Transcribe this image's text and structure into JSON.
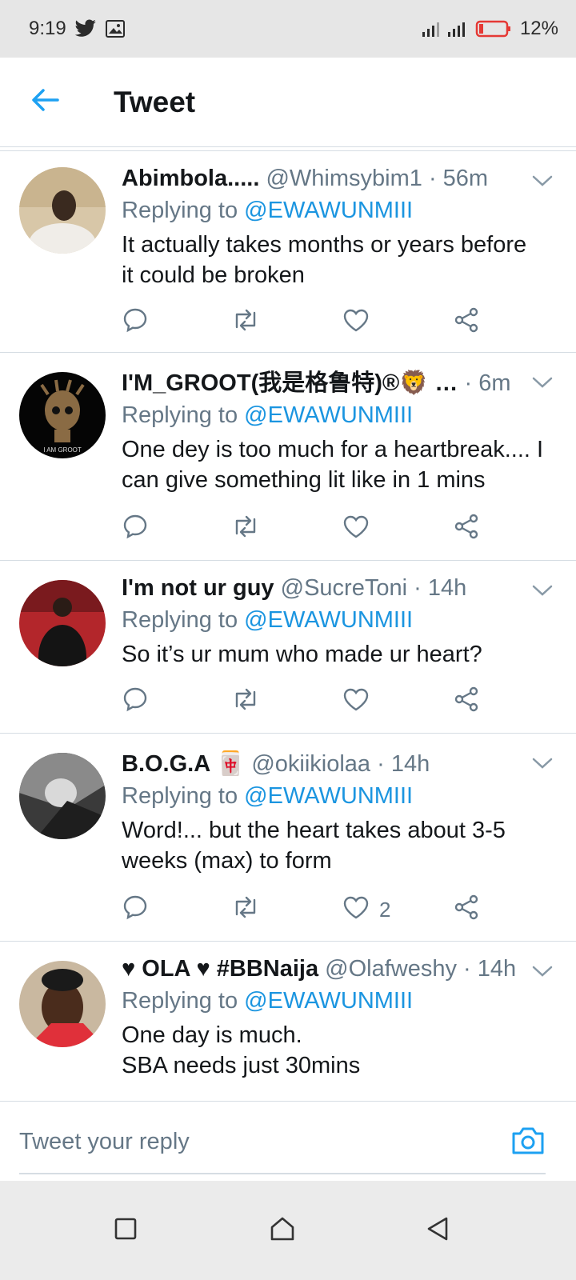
{
  "status_bar": {
    "time": "9:19",
    "battery": "12%",
    "battery_color": "#e53935",
    "icons": [
      "twitter-icon",
      "gallery-icon",
      "signal-icon",
      "battery-icon"
    ]
  },
  "header": {
    "title": "Tweet",
    "accent": "#1da1f2"
  },
  "tweets": [
    {
      "name": "Abimbola.....",
      "handle": "@Whimsybim1",
      "dot": "·",
      "time": "56m",
      "replying_prefix": "Replying to",
      "replying_to": "@EWAWUNMIII",
      "lines": [
        "It actually takes months or years before",
        "it could be broken"
      ],
      "likes": ""
    },
    {
      "name": "I'M_GROOT(我是格鲁特)®🦁 …",
      "handle": "",
      "dot": "·",
      "time": "6m",
      "replying_prefix": "Replying to",
      "replying_to": "@EWAWUNMIII",
      "lines": [
        "One dey is too much for a heartbreak.... I",
        "can give something lit like in 1 mins"
      ],
      "likes": ""
    },
    {
      "name": "I'm not ur guy",
      "handle": "@SucreToni",
      "dot": "·",
      "time": "14h",
      "replying_prefix": "Replying to",
      "replying_to": "@EWAWUNMIII",
      "lines": [
        "So it’s ur mum who made ur heart?"
      ],
      "likes": ""
    },
    {
      "name": "B.O.G.A 🀄",
      "handle": "@okiikiolaa",
      "dot": "·",
      "time": "14h",
      "replying_prefix": "Replying to",
      "replying_to": "@EWAWUNMIII",
      "lines": [
        "Word!... but the heart takes about 3-5",
        "weeks (max) to form"
      ],
      "likes": "2"
    },
    {
      "name": "♥ OLA ♥ #BBNaija",
      "handle": "@Olafweshy",
      "dot": "·",
      "time": "14h",
      "replying_prefix": "Replying to",
      "replying_to": "@EWAWUNMIII",
      "lines": [
        "One day is much.",
        "SBA needs just 30mins"
      ],
      "likes": ""
    }
  ],
  "composer": {
    "placeholder": "Tweet your reply"
  }
}
